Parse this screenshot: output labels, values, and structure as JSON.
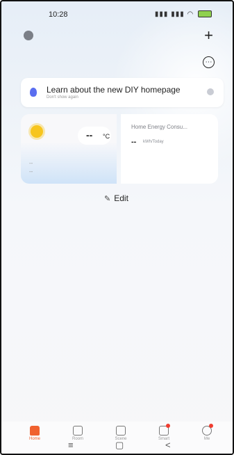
{
  "status_bar": {
    "time": "10:28",
    "signal_text": "¹⁰ᵃll ¹⁰ᵃll ♡",
    "battery_color": "#8fd14f"
  },
  "header": {
    "profile_icon": "profile-icon",
    "add_icon": "+",
    "more_icon": "⋯"
  },
  "tip": {
    "title": "Learn about the new DIY homepage",
    "subtitle": "Don't show again"
  },
  "weather": {
    "temperature": "--",
    "unit": "°C",
    "line1": "--",
    "line2": "--"
  },
  "energy": {
    "title": "Home Energy Consu...",
    "value": "--",
    "unit": "kWh/Today"
  },
  "edit": {
    "label": "Edit",
    "icon": "✎"
  },
  "tabs": [
    {
      "label": "Home",
      "icon": "home-icon",
      "active": true
    },
    {
      "label": "Room",
      "icon": "room-icon",
      "active": false
    },
    {
      "label": "Scene",
      "icon": "scene-icon",
      "active": false
    },
    {
      "label": "Smart",
      "icon": "smart-icon",
      "active": false
    },
    {
      "label": "Me",
      "icon": "me-icon",
      "active": false
    }
  ],
  "nav": {
    "menu_icon": "≡",
    "home_icon": "▢",
    "back_icon": "<"
  },
  "colors": {
    "accent": "#f0622f",
    "badge": "#f03c2f",
    "bulb": "#5a6ef0",
    "sun": "#f7c51e"
  }
}
